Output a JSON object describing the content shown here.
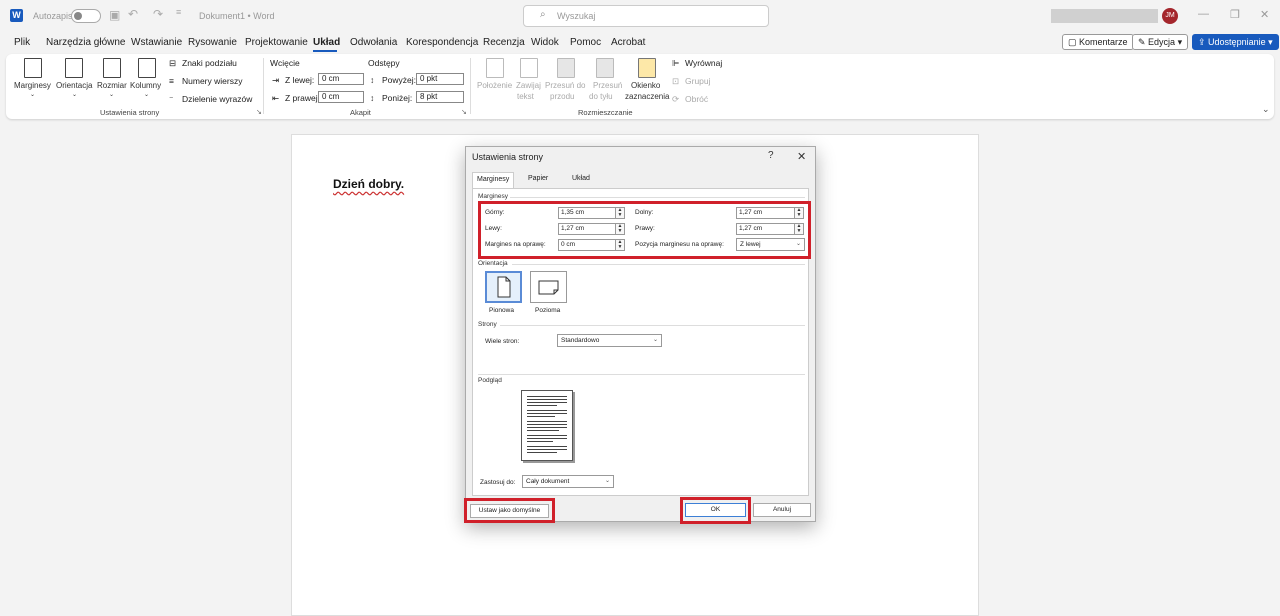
{
  "titlebar": {
    "autosave_label": "Autozapis",
    "doc_title": "Dokument1 • Word",
    "search_placeholder": "Wyszukaj",
    "user_initials": "JM"
  },
  "menu": {
    "items": [
      "Plik",
      "Narzędzia główne",
      "Wstawianie",
      "Rysowanie",
      "Projektowanie",
      "Układ",
      "Odwołania",
      "Korespondencja",
      "Recenzja",
      "Widok",
      "Pomoc",
      "Acrobat"
    ],
    "active": "Układ",
    "comments": "Komentarze",
    "editing": "Edycja",
    "share": "Udostępnianie"
  },
  "ribbon": {
    "page_setup": {
      "margins": "Marginesy",
      "orientation": "Orientacja",
      "size": "Rozmiar",
      "columns": "Kolumny",
      "breaks": "Znaki podziału",
      "line_numbers": "Numery wierszy",
      "hyphenation": "Dzielenie wyrazów",
      "group": "Ustawienia strony"
    },
    "paragraph": {
      "indent": "Wcięcie",
      "spacing": "Odstępy",
      "left": "Z lewej:",
      "left_val": "0 cm",
      "right": "Z prawej:",
      "right_val": "0 cm",
      "before": "Powyżej:",
      "before_val": "0 pkt",
      "after": "Poniżej:",
      "after_val": "8 pkt",
      "group": "Akapit"
    },
    "arrange": {
      "position": "Położenie",
      "wrap1": "Zawijaj",
      "wrap2": "tekst",
      "forward1": "Przesuń do",
      "forward2": "przodu",
      "back1": "Przesuń",
      "back2": "do tyłu",
      "pane1": "Okienko",
      "pane2": "zaznaczenia",
      "align": "Wyrównaj",
      "group_btn": "Grupuj",
      "rotate": "Obróć",
      "group": "Rozmieszczanie"
    }
  },
  "document": {
    "text": "Dzień dobry."
  },
  "dialog": {
    "title": "Ustawienia strony",
    "help": "?",
    "close": "✕",
    "tabs": [
      "Marginesy",
      "Papier",
      "Układ"
    ],
    "margins_section": "Marginesy",
    "top_label": "Górny:",
    "top_val": "1,35 cm",
    "bottom_label": "Dolny:",
    "bottom_val": "1,27 cm",
    "left_label": "Lewy:",
    "left_val": "1,27 cm",
    "right_label": "Prawy:",
    "right_val": "1,27 cm",
    "gutter_label": "Margines na oprawę:",
    "gutter_val": "0 cm",
    "gutter_pos_label": "Pozycja marginesu na oprawę:",
    "gutter_pos_val": "Z lewej",
    "orientation_section": "Orientacja",
    "portrait": "Pionowa",
    "landscape": "Pozioma",
    "pages_section": "Strony",
    "multiple_label": "Wiele stron:",
    "multiple_val": "Standardowo",
    "preview_section": "Podgląd",
    "apply_label": "Zastosuj do:",
    "apply_val": "Cały dokument",
    "set_default": "Ustaw jako domyślne",
    "ok": "OK",
    "cancel": "Anuluj"
  }
}
